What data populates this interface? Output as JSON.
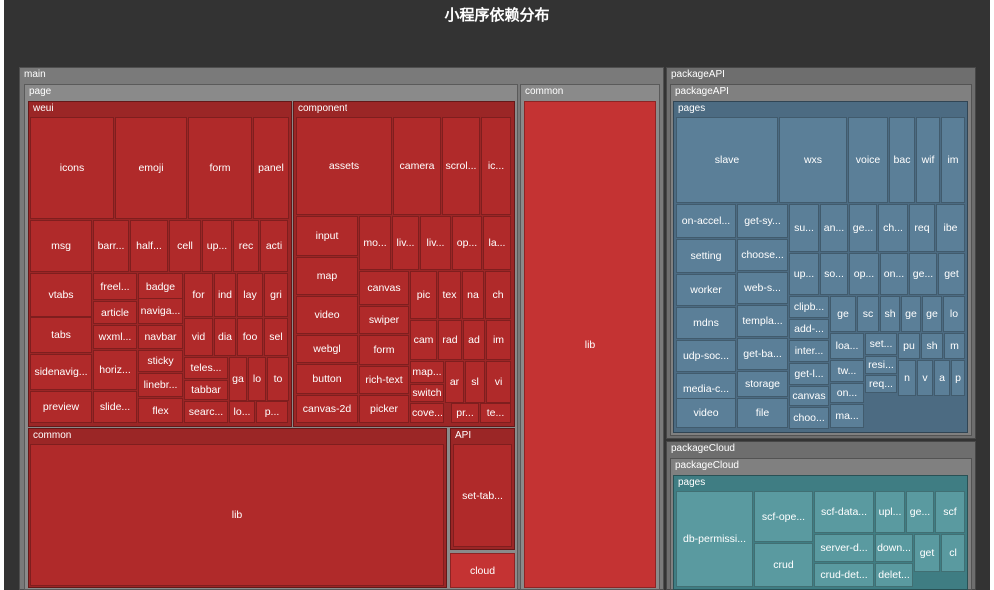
{
  "title": "小程序依赖分布",
  "colors": {
    "background": "#333333",
    "main": "#b02a2a",
    "main_common": "#c43333",
    "packageAPI": "#5b7f98",
    "packageCloud": "#5a9aa0",
    "group_border": "#777777"
  },
  "chart_data": {
    "type": "treemap",
    "title": "小程序依赖分布",
    "root": [
      {
        "name": "main",
        "children": [
          {
            "name": "page",
            "children": [
              {
                "name": "weui",
                "children": [
                  {
                    "name": "icons"
                  },
                  {
                    "name": "emoji"
                  },
                  {
                    "name": "form"
                  },
                  {
                    "name": "panel"
                  },
                  {
                    "name": "msg"
                  },
                  {
                    "name": "barr..."
                  },
                  {
                    "name": "half..."
                  },
                  {
                    "name": "cell"
                  },
                  {
                    "name": "up..."
                  },
                  {
                    "name": "rec"
                  },
                  {
                    "name": "acti"
                  },
                  {
                    "name": "vtabs"
                  },
                  {
                    "name": "freel..."
                  },
                  {
                    "name": "badge"
                  },
                  {
                    "name": "for"
                  },
                  {
                    "name": "ind"
                  },
                  {
                    "name": "lay"
                  },
                  {
                    "name": "gri"
                  },
                  {
                    "name": "article"
                  },
                  {
                    "name": "naviga..."
                  },
                  {
                    "name": "tabs"
                  },
                  {
                    "name": "navbar"
                  },
                  {
                    "name": "vid"
                  },
                  {
                    "name": "dia"
                  },
                  {
                    "name": "foo"
                  },
                  {
                    "name": "sel"
                  },
                  {
                    "name": "wxml..."
                  },
                  {
                    "name": "sticky"
                  },
                  {
                    "name": "sidenavig..."
                  },
                  {
                    "name": "horiz..."
                  },
                  {
                    "name": "teles..."
                  },
                  {
                    "name": "ga"
                  },
                  {
                    "name": "lo"
                  },
                  {
                    "name": "to"
                  },
                  {
                    "name": "linebr..."
                  },
                  {
                    "name": "tabbar"
                  },
                  {
                    "name": "preview"
                  },
                  {
                    "name": "slide..."
                  },
                  {
                    "name": "flex"
                  },
                  {
                    "name": "searc..."
                  },
                  {
                    "name": "lo..."
                  },
                  {
                    "name": "p..."
                  }
                ]
              },
              {
                "name": "component",
                "children": [
                  {
                    "name": "assets"
                  },
                  {
                    "name": "camera"
                  },
                  {
                    "name": "scrol..."
                  },
                  {
                    "name": "ic..."
                  },
                  {
                    "name": "input"
                  },
                  {
                    "name": "mo..."
                  },
                  {
                    "name": "liv..."
                  },
                  {
                    "name": "liv..."
                  },
                  {
                    "name": "op..."
                  },
                  {
                    "name": "la..."
                  },
                  {
                    "name": "map"
                  },
                  {
                    "name": "canvas"
                  },
                  {
                    "name": "pic"
                  },
                  {
                    "name": "tex"
                  },
                  {
                    "name": "na"
                  },
                  {
                    "name": "ch"
                  },
                  {
                    "name": "video"
                  },
                  {
                    "name": "swiper"
                  },
                  {
                    "name": "webgl"
                  },
                  {
                    "name": "form"
                  },
                  {
                    "name": "cam"
                  },
                  {
                    "name": "rad"
                  },
                  {
                    "name": "ad"
                  },
                  {
                    "name": "im"
                  },
                  {
                    "name": "button"
                  },
                  {
                    "name": "rich-text"
                  },
                  {
                    "name": "map..."
                  },
                  {
                    "name": "ar"
                  },
                  {
                    "name": "sl"
                  },
                  {
                    "name": "vi"
                  },
                  {
                    "name": "switch"
                  },
                  {
                    "name": "canvas-2d"
                  },
                  {
                    "name": "picker"
                  },
                  {
                    "name": "cove..."
                  },
                  {
                    "name": "pr..."
                  },
                  {
                    "name": "te..."
                  }
                ]
              },
              {
                "name": "common",
                "children": [
                  {
                    "name": "lib"
                  }
                ]
              },
              {
                "name": "API",
                "children": [
                  {
                    "name": "set-tab..."
                  }
                ]
              },
              {
                "name": "cloud"
              }
            ]
          },
          {
            "name": "common",
            "children": [
              {
                "name": "lib"
              }
            ]
          }
        ]
      },
      {
        "name": "packageAPI",
        "children": [
          {
            "name": "packageAPI",
            "children": [
              {
                "name": "pages",
                "children": [
                  {
                    "name": "slave"
                  },
                  {
                    "name": "wxs"
                  },
                  {
                    "name": "voice"
                  },
                  {
                    "name": "bac"
                  },
                  {
                    "name": "wif"
                  },
                  {
                    "name": "im"
                  },
                  {
                    "name": "on-accel..."
                  },
                  {
                    "name": "get-sy..."
                  },
                  {
                    "name": "su..."
                  },
                  {
                    "name": "an..."
                  },
                  {
                    "name": "ge..."
                  },
                  {
                    "name": "ch..."
                  },
                  {
                    "name": "req"
                  },
                  {
                    "name": "ibe"
                  },
                  {
                    "name": "setting"
                  },
                  {
                    "name": "choose..."
                  },
                  {
                    "name": "up..."
                  },
                  {
                    "name": "so..."
                  },
                  {
                    "name": "op..."
                  },
                  {
                    "name": "on..."
                  },
                  {
                    "name": "ge..."
                  },
                  {
                    "name": "get"
                  },
                  {
                    "name": "worker"
                  },
                  {
                    "name": "web-s..."
                  },
                  {
                    "name": "clipb..."
                  },
                  {
                    "name": "ge"
                  },
                  {
                    "name": "sc"
                  },
                  {
                    "name": "sh"
                  },
                  {
                    "name": "ge"
                  },
                  {
                    "name": "ge"
                  },
                  {
                    "name": "lo"
                  },
                  {
                    "name": "mdns"
                  },
                  {
                    "name": "templa..."
                  },
                  {
                    "name": "add-..."
                  },
                  {
                    "name": "udp-soc..."
                  },
                  {
                    "name": "get-ba..."
                  },
                  {
                    "name": "inter..."
                  },
                  {
                    "name": "loa..."
                  },
                  {
                    "name": "set..."
                  },
                  {
                    "name": "pu"
                  },
                  {
                    "name": "sh"
                  },
                  {
                    "name": "m"
                  },
                  {
                    "name": "resi..."
                  },
                  {
                    "name": "media-c..."
                  },
                  {
                    "name": "storage"
                  },
                  {
                    "name": "get-l..."
                  },
                  {
                    "name": "tw..."
                  },
                  {
                    "name": "req..."
                  },
                  {
                    "name": "n"
                  },
                  {
                    "name": "v"
                  },
                  {
                    "name": "a"
                  },
                  {
                    "name": "p"
                  },
                  {
                    "name": "canvas"
                  },
                  {
                    "name": "on..."
                  },
                  {
                    "name": "video"
                  },
                  {
                    "name": "file"
                  },
                  {
                    "name": "choo..."
                  },
                  {
                    "name": "ma..."
                  }
                ]
              }
            ]
          }
        ]
      },
      {
        "name": "packageCloud",
        "children": [
          {
            "name": "packageCloud",
            "children": [
              {
                "name": "pages",
                "children": [
                  {
                    "name": "db-permissi..."
                  },
                  {
                    "name": "scf-ope..."
                  },
                  {
                    "name": "scf-data..."
                  },
                  {
                    "name": "upl..."
                  },
                  {
                    "name": "ge..."
                  },
                  {
                    "name": "scf"
                  },
                  {
                    "name": "crud"
                  },
                  {
                    "name": "server-d..."
                  },
                  {
                    "name": "down..."
                  },
                  {
                    "name": "get"
                  },
                  {
                    "name": "cl"
                  },
                  {
                    "name": "crud-det..."
                  },
                  {
                    "name": "delet..."
                  }
                ]
              }
            ]
          }
        ]
      }
    ]
  }
}
